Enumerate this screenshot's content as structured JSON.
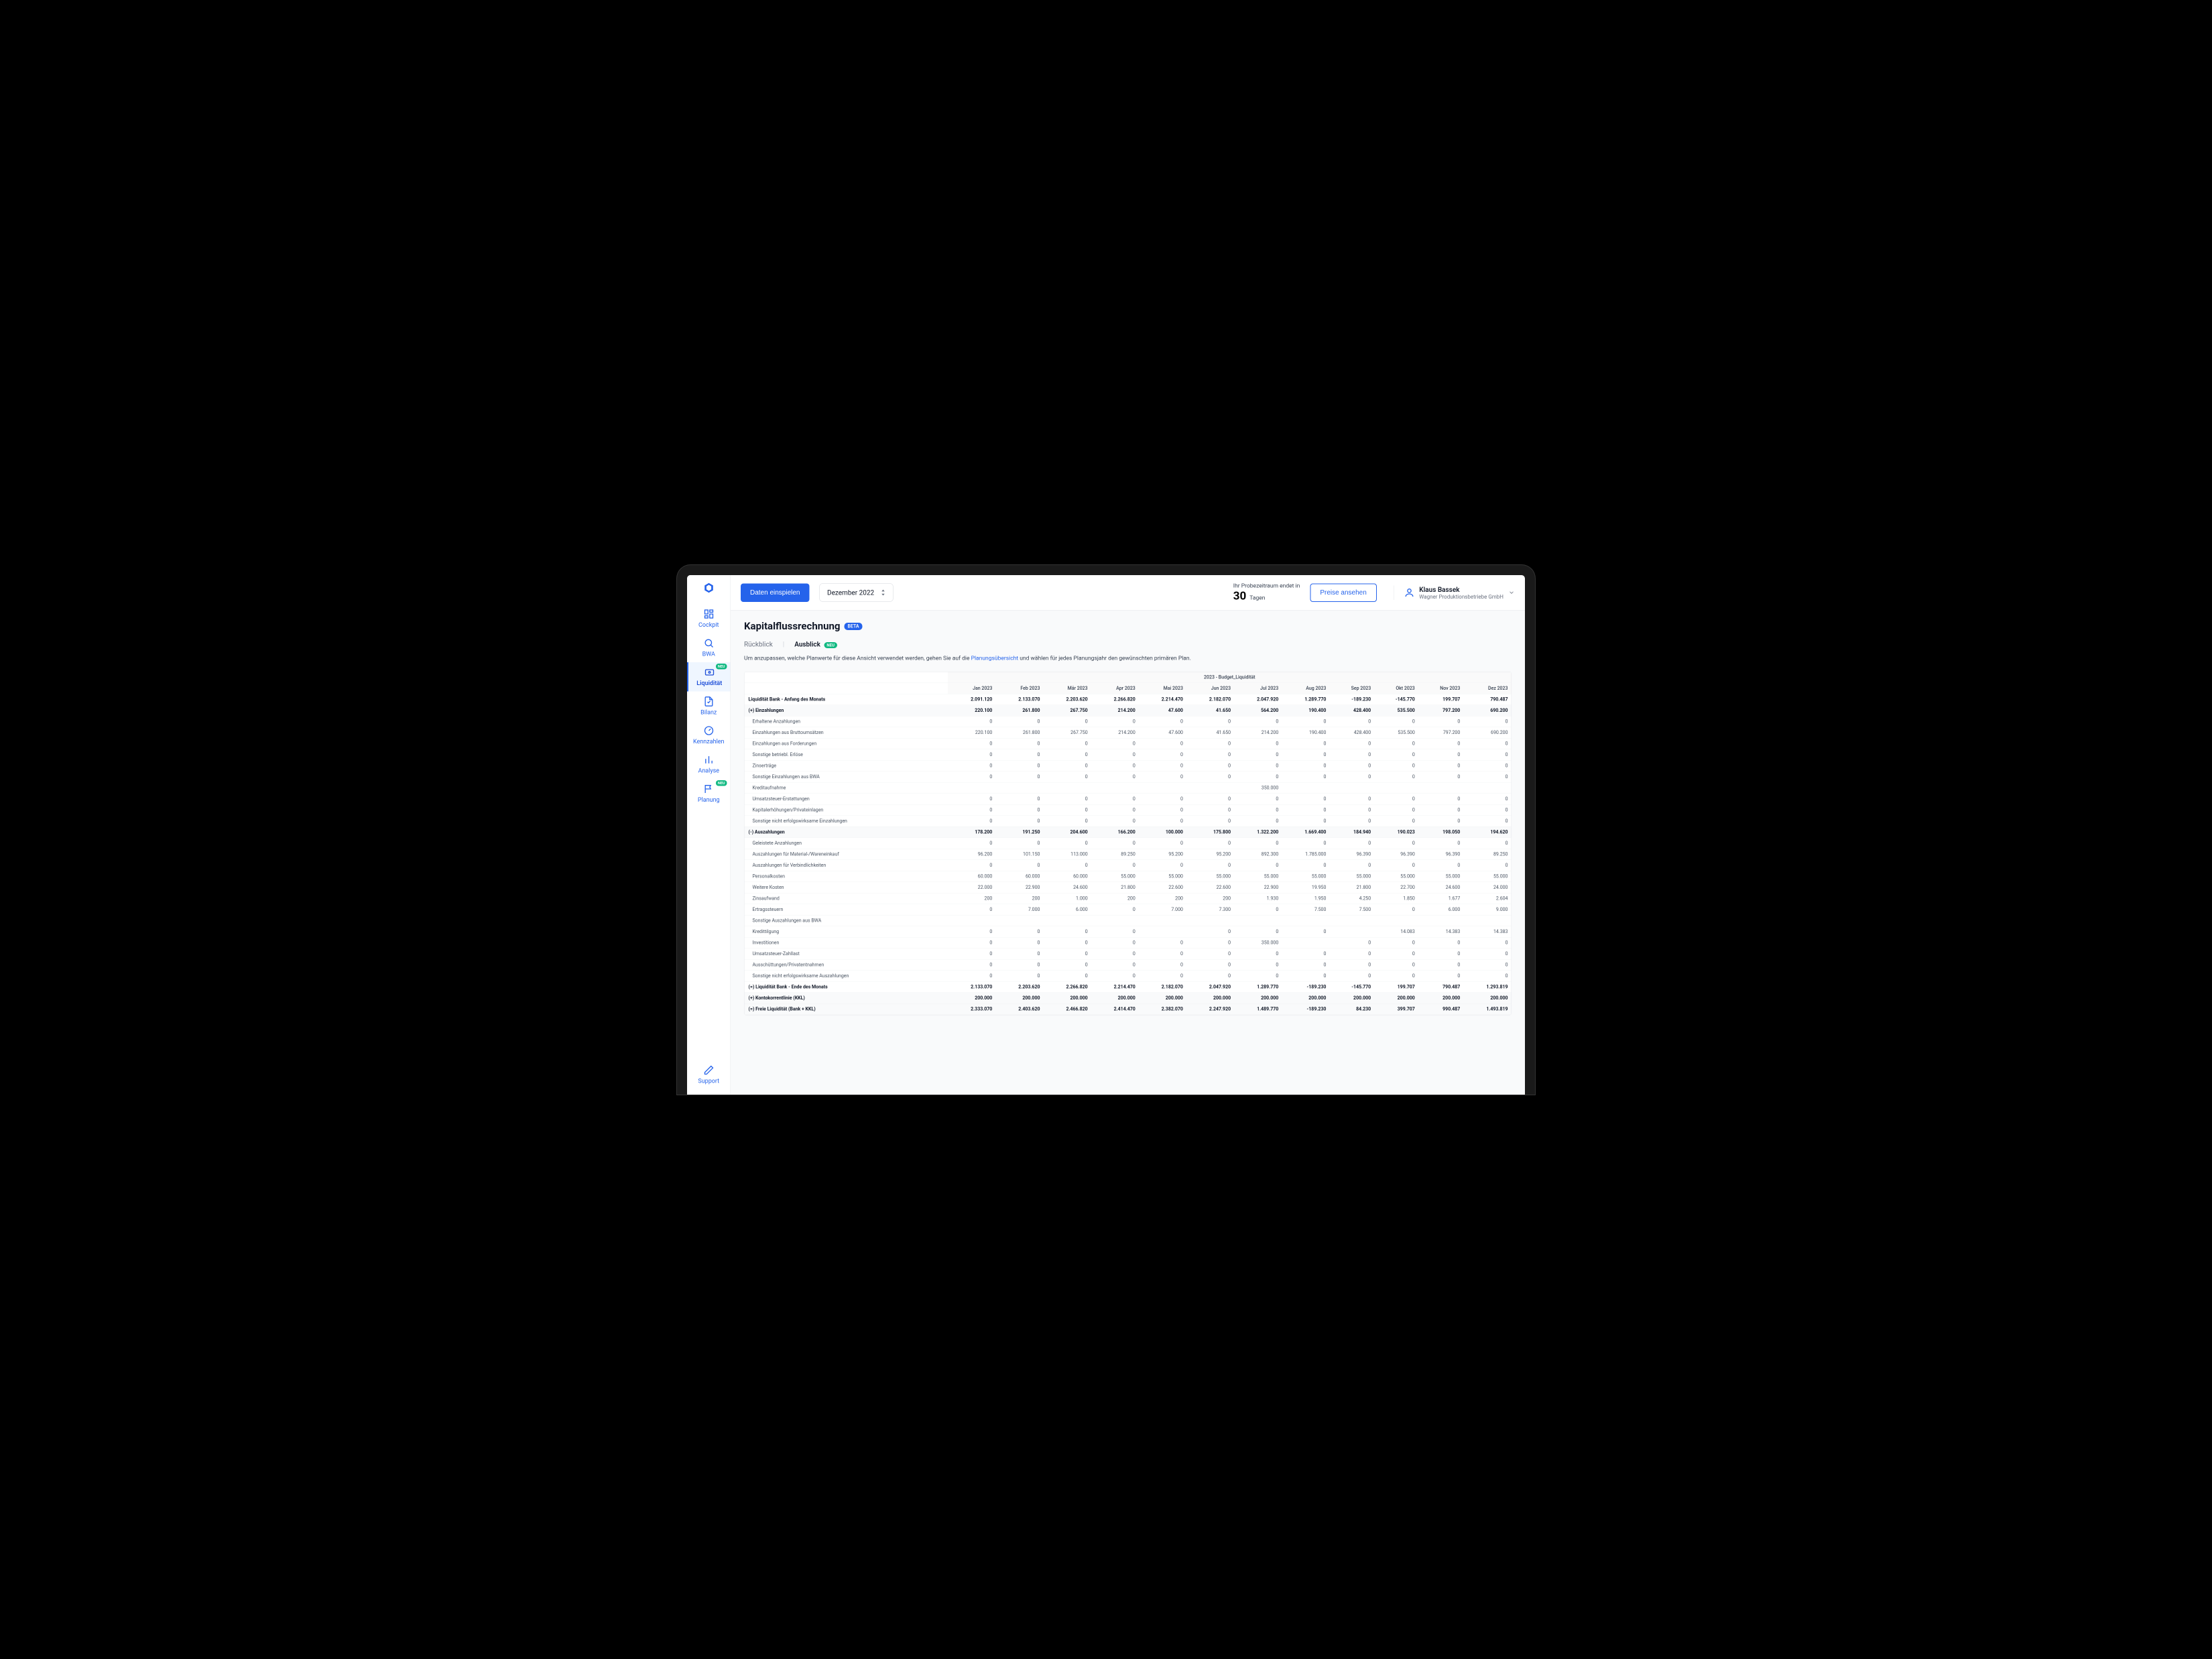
{
  "sidebar": {
    "items": [
      {
        "label": "Cockpit"
      },
      {
        "label": "BWA"
      },
      {
        "label": "Liquidität"
      },
      {
        "label": "Bilanz"
      },
      {
        "label": "Kennzahlen"
      },
      {
        "label": "Analyse"
      },
      {
        "label": "Planung"
      }
    ],
    "neu_badge": "NEU",
    "support": "Support"
  },
  "topbar": {
    "import_btn": "Daten einspielen",
    "month": "Dezember 2022",
    "trial_label": "Ihr Probezeitraum endet in",
    "trial_days": "30",
    "trial_unit": "Tagen",
    "pricing_btn": "Preise ansehen",
    "user_name": "Klaus Bassek",
    "user_company": "Wagner Produktionsbetriebe GmbH"
  },
  "page": {
    "title": "Kapitalflussrechnung",
    "beta": "BETA",
    "tab1": "Rückblick",
    "tab2": "Ausblick",
    "neu": "NEU",
    "hint_pre": "Um anzupassen, welche Planwerte für diese Ansicht verwendet werden, gehen Sie auf die ",
    "hint_link": "Planungsübersicht",
    "hint_post": " und wählen für jedes Planungsjahr den gewünschten primären Plan."
  },
  "table": {
    "super_header": "2023 - Budget_Liquidität",
    "months": [
      "Jan 2023",
      "Feb 2023",
      "Mär 2023",
      "Apr 2023",
      "Mai 2023",
      "Jun 2023",
      "Jul 2023",
      "Aug 2023",
      "Sep 2023",
      "Okt 2023",
      "Nov 2023",
      "Dez 2023"
    ],
    "rows": [
      {
        "label": "Liquidität Bank - Anfang des Monats",
        "bold": true,
        "vals": [
          "2.091.120",
          "2.133.070",
          "2.203.620",
          "2.266.820",
          "2.214.470",
          "2.182.070",
          "2.047.920",
          "1.289.770",
          "-189.230",
          "-145.770",
          "199.707",
          "790.487"
        ]
      },
      {
        "label": "(+) Einzahlungen",
        "bold": true,
        "shade": true,
        "vals": [
          "220.100",
          "261.800",
          "267.750",
          "214.200",
          "47.600",
          "41.650",
          "564.200",
          "190.400",
          "428.400",
          "535.500",
          "797.200",
          "690.200"
        ]
      },
      {
        "label": "Erhaltene Anzahlungen",
        "vals": [
          "0",
          "0",
          "0",
          "0",
          "0",
          "0",
          "0",
          "0",
          "0",
          "0",
          "0",
          "0"
        ]
      },
      {
        "label": "Einzahlungen aus Bruttoumsätzen",
        "vals": [
          "220.100",
          "261.800",
          "267.750",
          "214.200",
          "47.600",
          "41.650",
          "214.200",
          "190.400",
          "428.400",
          "535.500",
          "797.200",
          "690.200"
        ]
      },
      {
        "label": "Einzahlungen aus Forderungen",
        "vals": [
          "0",
          "0",
          "0",
          "0",
          "0",
          "0",
          "0",
          "0",
          "0",
          "0",
          "0",
          "0"
        ]
      },
      {
        "label": "Sonstige betriebl. Erlöse",
        "vals": [
          "0",
          "0",
          "0",
          "0",
          "0",
          "0",
          "0",
          "0",
          "0",
          "0",
          "0",
          "0"
        ]
      },
      {
        "label": "Zinserträge",
        "vals": [
          "0",
          "0",
          "0",
          "0",
          "0",
          "0",
          "0",
          "0",
          "0",
          "0",
          "0",
          "0"
        ]
      },
      {
        "label": "Sonstige Einzahlungen aus BWA",
        "vals": [
          "0",
          "0",
          "0",
          "0",
          "0",
          "0",
          "0",
          "0",
          "0",
          "0",
          "0",
          "0"
        ]
      },
      {
        "label": "Kreditaufnahme",
        "vals": [
          "",
          "",
          "",
          "",
          "",
          "",
          "350.000",
          "",
          "",
          "",
          "",
          ""
        ]
      },
      {
        "label": "Umsatzsteuer-Erstattungen",
        "vals": [
          "0",
          "0",
          "0",
          "0",
          "0",
          "0",
          "0",
          "0",
          "0",
          "0",
          "0",
          "0"
        ]
      },
      {
        "label": "Kapitalerhöhungen/Privateinlagen",
        "vals": [
          "0",
          "0",
          "0",
          "0",
          "0",
          "0",
          "0",
          "0",
          "0",
          "0",
          "0",
          "0"
        ]
      },
      {
        "label": "Sonstige nicht erfolgswirksame Einzahlungen",
        "vals": [
          "0",
          "0",
          "0",
          "0",
          "0",
          "0",
          "0",
          "0",
          "0",
          "0",
          "0",
          "0"
        ]
      },
      {
        "label": "(-) Auszahlungen",
        "bold": true,
        "shade": true,
        "vals": [
          "178.200",
          "191.250",
          "204.600",
          "166.200",
          "100.000",
          "175.800",
          "1.322.200",
          "1.669.400",
          "184.940",
          "190.023",
          "198.050",
          "194.620"
        ]
      },
      {
        "label": "Geleistete Anzahlungen",
        "vals": [
          "0",
          "0",
          "0",
          "0",
          "0",
          "0",
          "0",
          "0",
          "0",
          "0",
          "0",
          "0"
        ]
      },
      {
        "label": "Auszahlungen für Material-/Wareneinkauf",
        "vals": [
          "96.200",
          "101.150",
          "113.000",
          "89.250",
          "95.200",
          "95.200",
          "892.300",
          "1.785.000",
          "96.390",
          "96.390",
          "96.390",
          "89.250"
        ]
      },
      {
        "label": "Auszahlungen für Verbindlichkeiten",
        "vals": [
          "0",
          "0",
          "0",
          "0",
          "0",
          "0",
          "0",
          "0",
          "0",
          "0",
          "0",
          "0"
        ]
      },
      {
        "label": "Personalkosten",
        "vals": [
          "60.000",
          "60.000",
          "60.000",
          "55.000",
          "55.000",
          "55.000",
          "55.000",
          "55.000",
          "55.000",
          "55.000",
          "55.000",
          "55.000"
        ]
      },
      {
        "label": "Weitere Kosten",
        "vals": [
          "22.000",
          "22.900",
          "24.600",
          "21.800",
          "22.600",
          "22.600",
          "22.900",
          "19.950",
          "21.800",
          "22.700",
          "24.600",
          "24.000"
        ]
      },
      {
        "label": "Zinsaufwand",
        "vals": [
          "200",
          "200",
          "1.000",
          "200",
          "200",
          "200",
          "1.930",
          "1.950",
          "4.250",
          "1.850",
          "1.677",
          "2.604"
        ]
      },
      {
        "label": "Ertragssteuern",
        "vals": [
          "0",
          "7.000",
          "6.000",
          "0",
          "7.000",
          "7.300",
          "0",
          "7.500",
          "7.500",
          "0",
          "6.000",
          "9.000"
        ]
      },
      {
        "label": "Sonstige Auszahlungen aus BWA",
        "vals": [
          "",
          "",
          "",
          "",
          "",
          "",
          "",
          "",
          "",
          "",
          "",
          ""
        ]
      },
      {
        "label": "Kredittilgung",
        "vals": [
          "0",
          "0",
          "0",
          "0",
          "",
          "0",
          "0",
          "0",
          "",
          "14.083",
          "14.383",
          "14.383"
        ]
      },
      {
        "label": "Investitionen",
        "vals": [
          "0",
          "0",
          "0",
          "0",
          "0",
          "0",
          "350.000",
          "",
          "0",
          "0",
          "0",
          "0"
        ]
      },
      {
        "label": "Umsatzsteuer-Zahllast",
        "vals": [
          "0",
          "0",
          "0",
          "0",
          "0",
          "0",
          "0",
          "0",
          "0",
          "0",
          "0",
          "0"
        ]
      },
      {
        "label": "Ausschüttungen/Privatentnahmen",
        "vals": [
          "0",
          "0",
          "0",
          "0",
          "0",
          "0",
          "0",
          "0",
          "0",
          "0",
          "0",
          "0"
        ]
      },
      {
        "label": "Sonstige nicht erfolgswirksame Auszahlungen",
        "vals": [
          "0",
          "0",
          "0",
          "0",
          "0",
          "0",
          "0",
          "0",
          "0",
          "0",
          "0",
          "0"
        ]
      },
      {
        "label": "(=) Liquidität Bank - Ende des Monats",
        "bold": true,
        "vals": [
          "2.133.070",
          "2.203.620",
          "2.266.820",
          "2.214.470",
          "2.182.070",
          "2.047.920",
          "1.289.770",
          "-189.230",
          "-145.770",
          "199.707",
          "790.487",
          "1.293.819"
        ]
      },
      {
        "label": "(+) Kontokorrentlinie (KKL)",
        "bold": true,
        "shade": true,
        "vals": [
          "200.000",
          "200.000",
          "200.000",
          "200.000",
          "200.000",
          "200.000",
          "200.000",
          "200.000",
          "200.000",
          "200.000",
          "200.000",
          "200.000"
        ]
      },
      {
        "label": "(=) Freie Liquidität (Bank + KKL)",
        "bold": true,
        "shade": true,
        "vals": [
          "2.333.070",
          "2.403.620",
          "2.466.820",
          "2.414.470",
          "2.382.070",
          "2.247.920",
          "1.489.770",
          "-189.230",
          "84.230",
          "399.707",
          "990.487",
          "1.493.819"
        ]
      }
    ]
  }
}
